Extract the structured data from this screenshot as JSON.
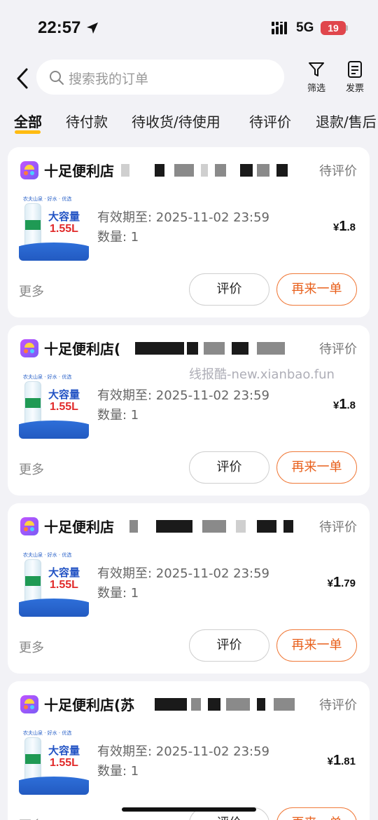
{
  "status_bar": {
    "time": "22:57",
    "network": "5G",
    "battery": "19"
  },
  "header": {
    "search_placeholder": "搜索我的订单",
    "filter_label": "筛选",
    "invoice_label": "发票"
  },
  "tabs": [
    "全部",
    "待付款",
    "待收货/待使用",
    "待评价",
    "退款/售后"
  ],
  "orders": [
    {
      "store": "十足便利店",
      "status": "待评价",
      "thumb_brand": "农夫山泉 · 好水 · 优选",
      "thumb_title": "大容量",
      "thumb_volume": "1.55L",
      "validity": "有效期至: 2025-11-02 23:59",
      "qty": "数量: 1",
      "price_int": "1",
      "price_dec": ".8",
      "more": "更多",
      "review": "评价",
      "again": "再来一单"
    },
    {
      "store": "十足便利店(",
      "status": "待评价",
      "thumb_brand": "农夫山泉 · 好水 · 优选",
      "thumb_title": "大容量",
      "thumb_volume": "1.55L",
      "validity": "有效期至: 2025-11-02 23:59",
      "qty": "数量: 1",
      "price_int": "1",
      "price_dec": ".8",
      "more": "更多",
      "review": "评价",
      "again": "再来一单"
    },
    {
      "store": "十足便利店",
      "status": "待评价",
      "thumb_brand": "农夫山泉 · 好水 · 优选",
      "thumb_title": "大容量",
      "thumb_volume": "1.55L",
      "validity": "有效期至: 2025-11-02 23:59",
      "qty": "数量: 1",
      "price_int": "1",
      "price_dec": ".79",
      "more": "更多",
      "review": "评价",
      "again": "再来一单"
    },
    {
      "store": "十足便利店(苏",
      "status": "待评价",
      "thumb_brand": "农夫山泉 · 好水 · 优选",
      "thumb_title": "大容量",
      "thumb_volume": "1.55L",
      "validity": "有效期至: 2025-11-02 23:59",
      "qty": "数量: 1",
      "price_int": "1",
      "price_dec": ".81",
      "more": "更多",
      "review": "评价",
      "again": "再来一单"
    }
  ],
  "watermark": "线报酷-new.xianbao.fun",
  "currency": "¥",
  "colors": {
    "accent": "#ffbb11",
    "again_button": "#e8601c"
  }
}
